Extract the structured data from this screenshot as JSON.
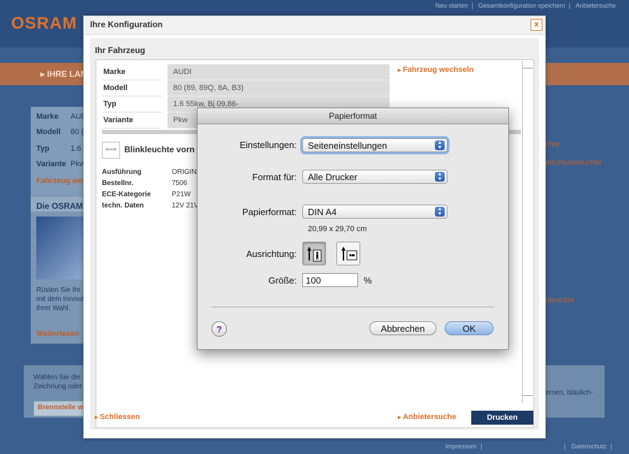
{
  "background": {
    "logo": "OSRAM",
    "top_links": [
      "Neu starten",
      "Gesamtkonfiguration speichern",
      "Anbietersuche"
    ],
    "band_text": "▸ IHRE LAM",
    "left_rows": [
      [
        "Marke",
        "AUD"
      ],
      [
        "Modell",
        "80 ("
      ],
      [
        "Typ",
        "1.6"
      ],
      [
        "Variante",
        "Pkw"
      ]
    ],
    "left_link": "Fahrzeug we",
    "left_heading": "Die OSRAM",
    "left_body": [
      "Rüsten Sie Ihr",
      "mit dem Innova",
      "Ihrer Wahl."
    ],
    "left_more": "Weiterlesen",
    "right_texts": [
      "chte",
      "elschlussleuchte",
      "nleuchte"
    ],
    "bottom_text": [
      "Wählen Sie die",
      "Zeichnung oder"
    ],
    "bottom_right": "ernen, bläulich-",
    "brennstelle": "Brennstelle w",
    "footer_links": [
      "Impressum",
      "Datenschutz"
    ]
  },
  "config": {
    "title": "Ihre Konfiguration",
    "close": "x",
    "section_title": "Ihr Fahrzeug",
    "vehicle": [
      {
        "label": "Marke",
        "value": "AUDI"
      },
      {
        "label": "Modell",
        "value": "80 (89, 89Q, 8A, B3)"
      },
      {
        "label": "Typ",
        "value": "1.6 55kw, Bj 09.86-"
      },
      {
        "label": "Variante",
        "value": "Pkw"
      }
    ],
    "change_vehicle": "Fahrzeug wechseln",
    "blink_icon": "⇦⇨",
    "blink_title": "Blinkleuchte vorn",
    "specs": [
      {
        "label": "Ausführung",
        "value": "ORIGINA"
      },
      {
        "label": "Bestellnr.",
        "value": "7506"
      },
      {
        "label": "ECE-Kategorie",
        "value": "P21W"
      },
      {
        "label": "techn. Daten",
        "value": "12V 21V"
      }
    ],
    "close_link": "Schliessen",
    "dealer_link": "Anbietersuche",
    "print_button": "Drucken"
  },
  "dialog": {
    "title": "Papierformat",
    "settings_label": "Einstellungen:",
    "settings_value": "Seiteneinstellungen",
    "format_for_label": "Format für:",
    "format_for_value": "Alle Drucker",
    "paper_label": "Papierformat:",
    "paper_value": "DIN A4",
    "paper_size": "20,99 x 29,70 cm",
    "orientation_label": "Ausrichtung:",
    "size_label": "Größe:",
    "size_value": "100",
    "size_unit": "%",
    "help": "?",
    "cancel": "Abbrechen",
    "ok": "OK"
  }
}
